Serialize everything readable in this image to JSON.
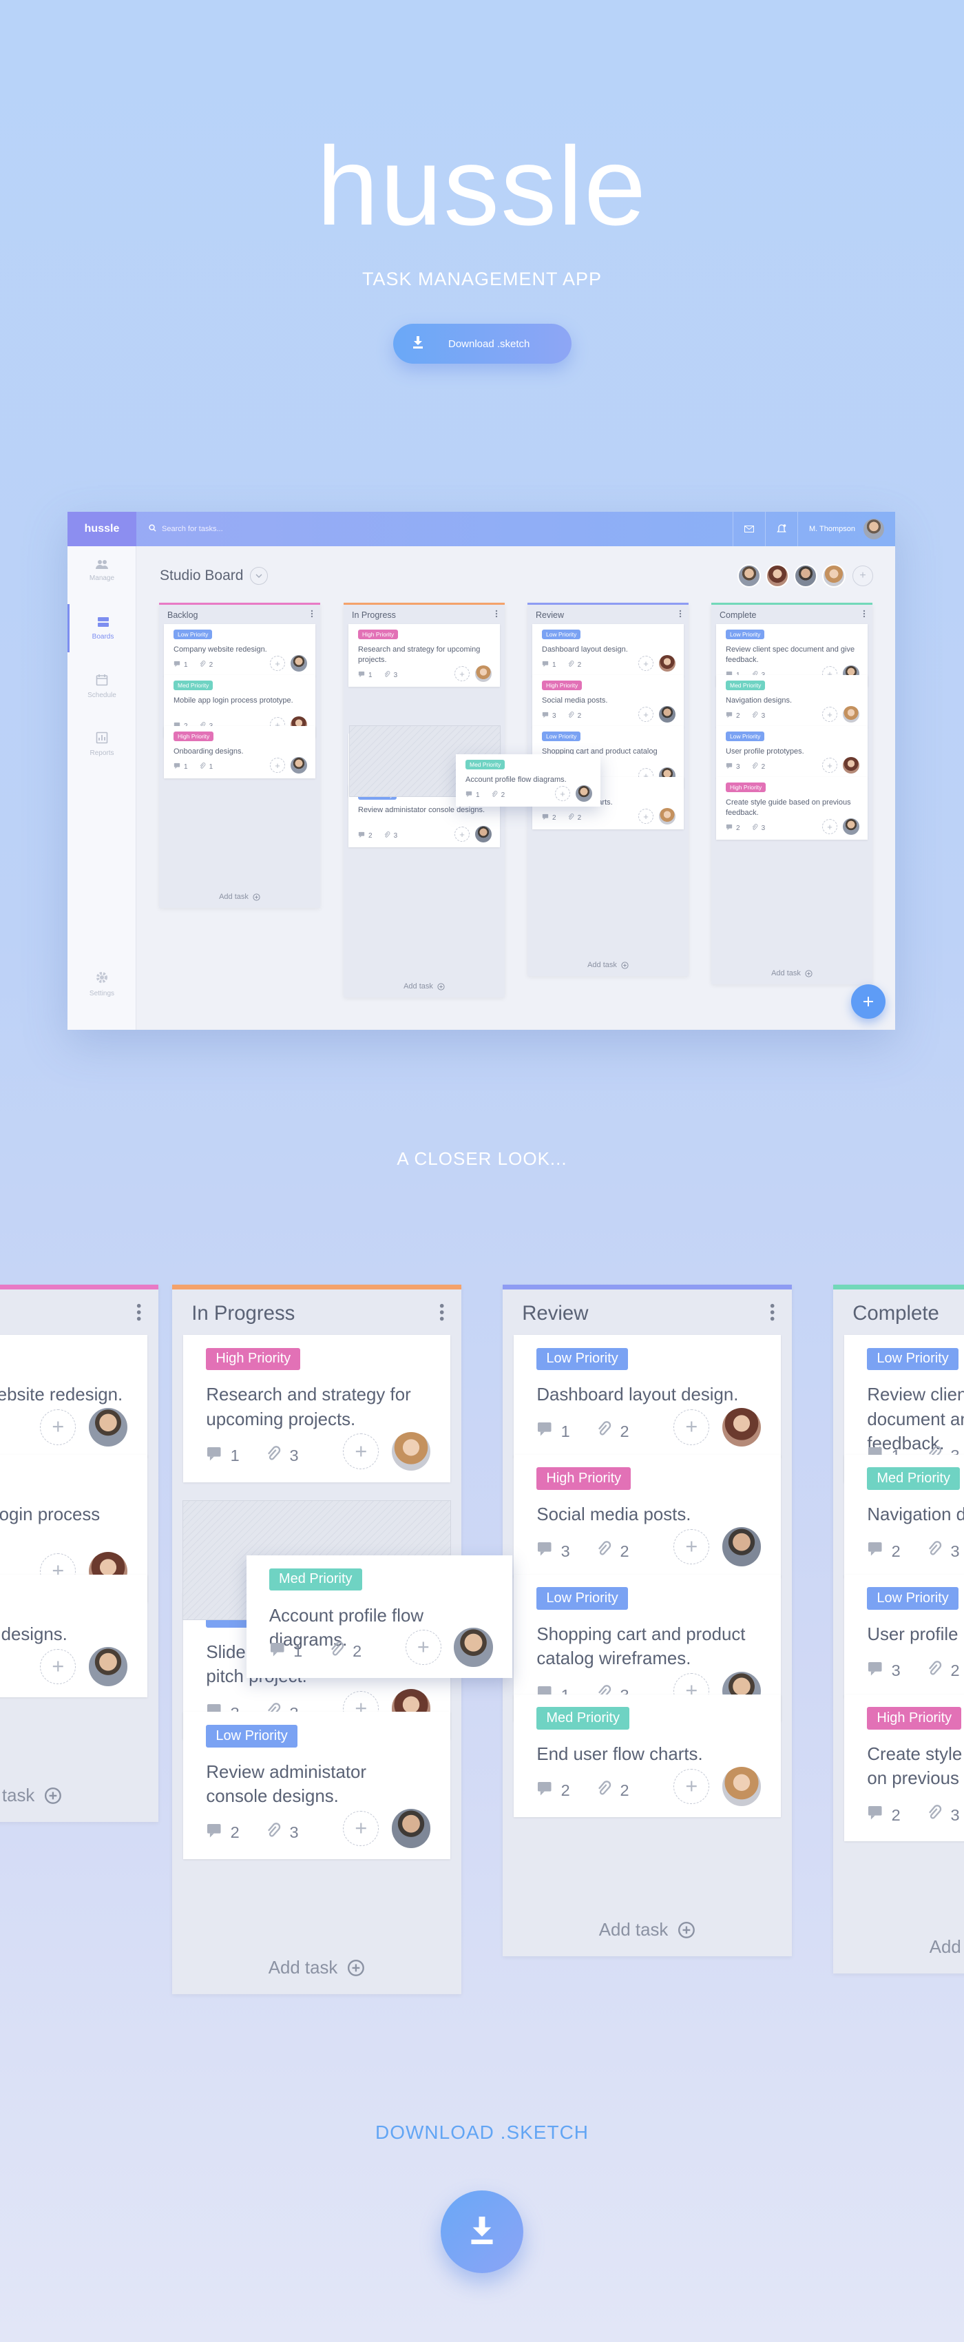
{
  "hero": {
    "title": "hussle",
    "subtitle": "TASK MANAGEMENT APP",
    "download_label": "Download .sketch"
  },
  "app": {
    "brand": "hussle",
    "search_placeholder": "Search for tasks...",
    "user_name": "M. Thompson",
    "board_title": "Studio Board",
    "sidebar": [
      {
        "label": "Manage",
        "icon": "users-icon",
        "active": false
      },
      {
        "label": "Boards",
        "icon": "boards-icon",
        "active": true
      },
      {
        "label": "Schedule",
        "icon": "calendar-icon",
        "active": false
      },
      {
        "label": "Reports",
        "icon": "chart-icon",
        "active": false
      }
    ],
    "settings_label": "Settings",
    "add_task_label": "Add task"
  },
  "colors": {
    "low": "#7aa2f3",
    "med": "#6fd3c3",
    "high": "#e271b6",
    "backlog": "#e87ac5",
    "in_progress": "#f4a26b",
    "review": "#8e9cf3",
    "complete": "#72d8b9"
  },
  "columns": [
    {
      "name": "Backlog",
      "cards": [
        {
          "tag": "Low Priority",
          "level": "low",
          "title": "Company website redesign.",
          "comments": "1",
          "attachments": "2"
        },
        {
          "tag": "Med Priority",
          "level": "med",
          "title": "Mobile app login process prototype.",
          "comments": "2",
          "attachments": "3"
        },
        {
          "tag": "High Priority",
          "level": "high",
          "title": "Onboarding designs.",
          "comments": "1",
          "attachments": "1"
        }
      ]
    },
    {
      "name": "In Progress",
      "cards": [
        {
          "tag": "High Priority",
          "level": "high",
          "title": "Research and strategy for upcoming projects.",
          "comments": "1",
          "attachments": "3"
        },
        {
          "tag": "Low Priority",
          "level": "low",
          "title": "Slide templates for client pitch project.",
          "comments": "3",
          "attachments": "3"
        },
        {
          "tag": "Low Priority",
          "level": "low",
          "title": "Review administator console designs.",
          "comments": "2",
          "attachments": "3"
        }
      ]
    },
    {
      "name": "Review",
      "cards": [
        {
          "tag": "Low Priority",
          "level": "low",
          "title": "Dashboard layout design.",
          "comments": "1",
          "attachments": "2"
        },
        {
          "tag": "High Priority",
          "level": "high",
          "title": "Social media posts.",
          "comments": "3",
          "attachments": "2"
        },
        {
          "tag": "Low Priority",
          "level": "low",
          "title": "Shopping cart and product catalog wireframes.",
          "comments": "1",
          "attachments": "3"
        },
        {
          "tag": "Med Priority",
          "level": "med",
          "title": "End user flow charts.",
          "comments": "2",
          "attachments": "2"
        }
      ]
    },
    {
      "name": "Complete",
      "cards": [
        {
          "tag": "Low Priority",
          "level": "low",
          "title": "Review client spec document and give feedback.",
          "comments": "1",
          "attachments": "3"
        },
        {
          "tag": "Med Priority",
          "level": "med",
          "title": "Navigation designs.",
          "comments": "2",
          "attachments": "3"
        },
        {
          "tag": "Low Priority",
          "level": "low",
          "title": "User profile prototypes.",
          "comments": "3",
          "attachments": "2"
        },
        {
          "tag": "High Priority",
          "level": "high",
          "title": "Create style guide based on previous feedback.",
          "comments": "2",
          "attachments": "3"
        }
      ]
    }
  ],
  "dragging": {
    "tag": "Med Priority",
    "level": "med",
    "title": "Account profile flow diagrams.",
    "comments": "1",
    "attachments": "2"
  },
  "closer_label": "A CLOSER LOOK...",
  "download_section": {
    "title": "DOWNLOAD .SKETCH"
  }
}
